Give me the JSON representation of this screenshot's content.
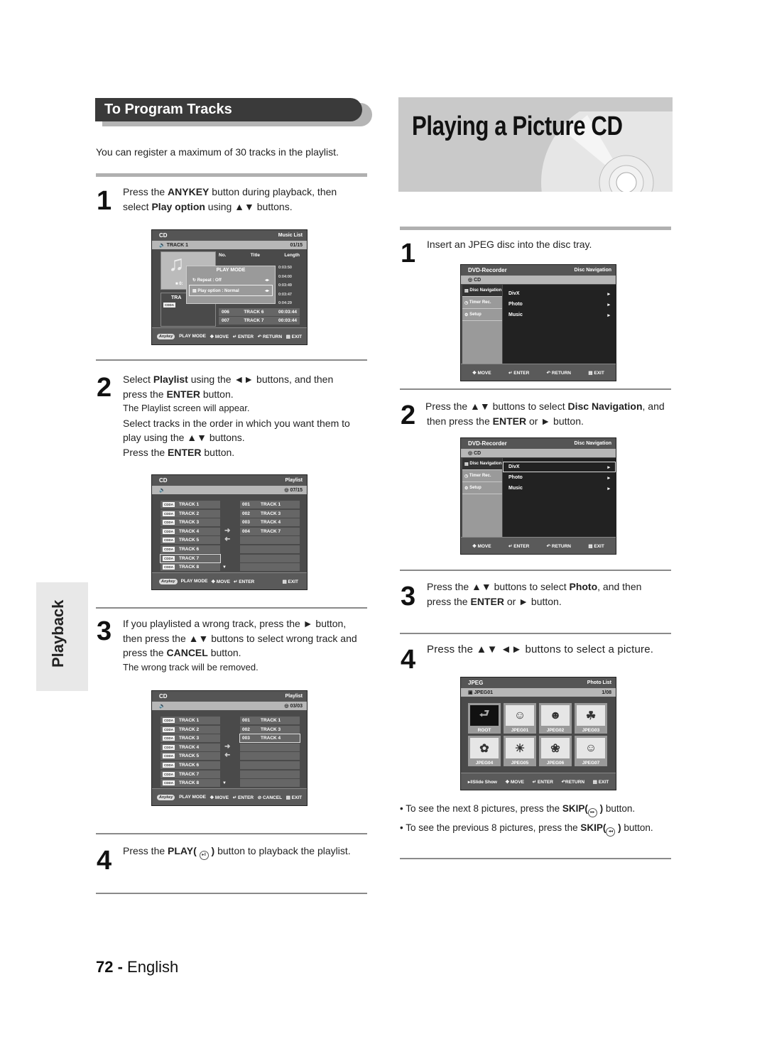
{
  "left_section": {
    "header": "To Program Tracks",
    "intro": "You can register a maximum of 30 tracks in the playlist.",
    "steps": [
      {
        "num": "1",
        "line1_pre": "Press the ",
        "line1_bold": "ANYKEY",
        "line1_post": " button during playback, then",
        "line2_pre": "select ",
        "line2_bold": "Play option",
        "line2_post": " using ▲▼ buttons."
      },
      {
        "num": "2",
        "line1_pre": "Select ",
        "line1_bold": "Playlist",
        "line1_post": " using the ◄►  buttons, and then",
        "line2_pre": "press the ",
        "line2_bold": "ENTER",
        "line2_post": " button.",
        "sub1": "The Playlist screen will appear.",
        "sub2": "Select tracks in the order in which you want them to",
        "sub3": "play using the ▲▼  buttons.",
        "sub4_pre": "Press the ",
        "sub4_bold": "ENTER",
        "sub4_post": " button."
      },
      {
        "num": "3",
        "line1": "If you playlisted a wrong track, press the ► button,",
        "line2": "then press the ▲▼ buttons to select wrong track and",
        "line3_pre": "press the ",
        "line3_bold": "CANCEL",
        "line3_post": " button.",
        "sub1": "The wrong track will be removed."
      },
      {
        "num": "4",
        "pre": "Press the ",
        "bold": "PLAY(",
        "icon": "▸‖",
        "bold2": " )",
        "post": " button to playback the playlist."
      }
    ]
  },
  "osd_music_list": {
    "top_left": "CD",
    "top_right": "Music List",
    "sub_left": "TRACK 1",
    "sub_right": "01/15",
    "columns": [
      "No.",
      "Title",
      "Length"
    ],
    "lengths": [
      "0:03:50",
      "0:04:00",
      "0:03:49",
      "0:03:47",
      "0:04:29"
    ],
    "rows": [
      {
        "no": "006",
        "title": "TRACK 6",
        "length": "00:03:44"
      },
      {
        "no": "007",
        "title": "TRACK 7",
        "length": "00:03:44"
      }
    ],
    "left_panel_time": "■ 0:",
    "left_panel_track": "TRA",
    "cdda": "CDDA",
    "popup_title": "PLAY MODE",
    "popup_items": [
      "Repeat : Off",
      "Play option : Normal"
    ],
    "footer": [
      "Anykey",
      "PLAY MODE",
      "MOVE",
      "ENTER",
      "RETURN",
      "EXIT"
    ]
  },
  "osd_playlist_1": {
    "top_left": "CD",
    "top_right": "Playlist",
    "sub_right": "07/15",
    "left_tracks": [
      "TRACK 1",
      "TRACK 2",
      "TRACK 3",
      "TRACK 4",
      "TRACK 5",
      "TRACK 6",
      "TRACK 7",
      "TRACK 8"
    ],
    "right_tracks": [
      {
        "no": "001",
        "title": "TRACK 1"
      },
      {
        "no": "002",
        "title": "TRACK 3"
      },
      {
        "no": "003",
        "title": "TRACK 4"
      },
      {
        "no": "004",
        "title": "TRACK 7"
      }
    ],
    "cdda": "CDDA",
    "footer": [
      "Anykey",
      "PLAY MODE",
      "MOVE",
      "ENTER",
      "EXIT"
    ]
  },
  "osd_playlist_2": {
    "top_left": "CD",
    "top_right": "Playlist",
    "sub_right": "03/03",
    "left_tracks": [
      "TRACK 1",
      "TRACK 2",
      "TRACK 3",
      "TRACK 4",
      "TRACK 5",
      "TRACK 6",
      "TRACK 7",
      "TRACK 8"
    ],
    "right_tracks": [
      {
        "no": "001",
        "title": "TRACK 1"
      },
      {
        "no": "002",
        "title": "TRACK 3"
      },
      {
        "no": "003",
        "title": "TRACK 4"
      }
    ],
    "cdda": "CDDA",
    "footer": [
      "Anykey",
      "PLAY MODE",
      "MOVE",
      "ENTER",
      "CANCEL",
      "EXIT"
    ]
  },
  "right_section": {
    "title": "Playing a Picture CD",
    "steps": [
      {
        "num": "1",
        "text": "Insert an JPEG disc into the disc tray."
      },
      {
        "num": "2",
        "line1_pre": "Press the ▲▼ buttons to select ",
        "line1_bold": "Disc Navigation",
        "line1_post": ", and",
        "line2_pre": "then press the ",
        "line2_bold": "ENTER",
        "line2_post": " or ► button."
      },
      {
        "num": "3",
        "line1_pre": "Press the ▲▼ buttons to select ",
        "line1_bold": "Photo",
        "line1_post": ", and then",
        "line2_pre": "press the ",
        "line2_bold": "ENTER",
        "line2_post": " or ► button."
      },
      {
        "num": "4",
        "text": "Press the ▲▼ ◄►  buttons to select a picture."
      }
    ],
    "bullets": [
      {
        "pre": "• To see the next 8 pictures, press the ",
        "bold": "SKIP(",
        "bold2": " )",
        "post": " button."
      },
      {
        "pre": "• To see the previous 8 pictures, press the ",
        "bold": "SKIP(",
        "bold2": " )",
        "post": " button."
      }
    ]
  },
  "osd_disc_nav": {
    "top_left": "DVD-Recorder",
    "top_right": "Disc Navigation",
    "sub_left": "CD",
    "side_items": [
      "Disc Navigation",
      "Timer Rec.",
      "Setup"
    ],
    "main_items": [
      "DivX",
      "Photo",
      "Music"
    ],
    "footer": [
      "MOVE",
      "ENTER",
      "RETURN",
      "EXIT"
    ]
  },
  "osd_photo_list": {
    "top_left": "JPEG",
    "top_right": "Photo List",
    "sub_left": "JPEG01",
    "sub_right": "1/08",
    "thumbs": [
      "ROOT",
      "JPEG01",
      "JPEG02",
      "JPEG03",
      "JPEG04",
      "JPEG05",
      "JPEG06",
      "JPEG07"
    ],
    "footer": [
      "Slide Show",
      "MOVE",
      "ENTER",
      "RETURN",
      "EXIT"
    ]
  },
  "side_tab": "Playback",
  "footer": {
    "page_num": "72 -",
    "language": "English"
  }
}
